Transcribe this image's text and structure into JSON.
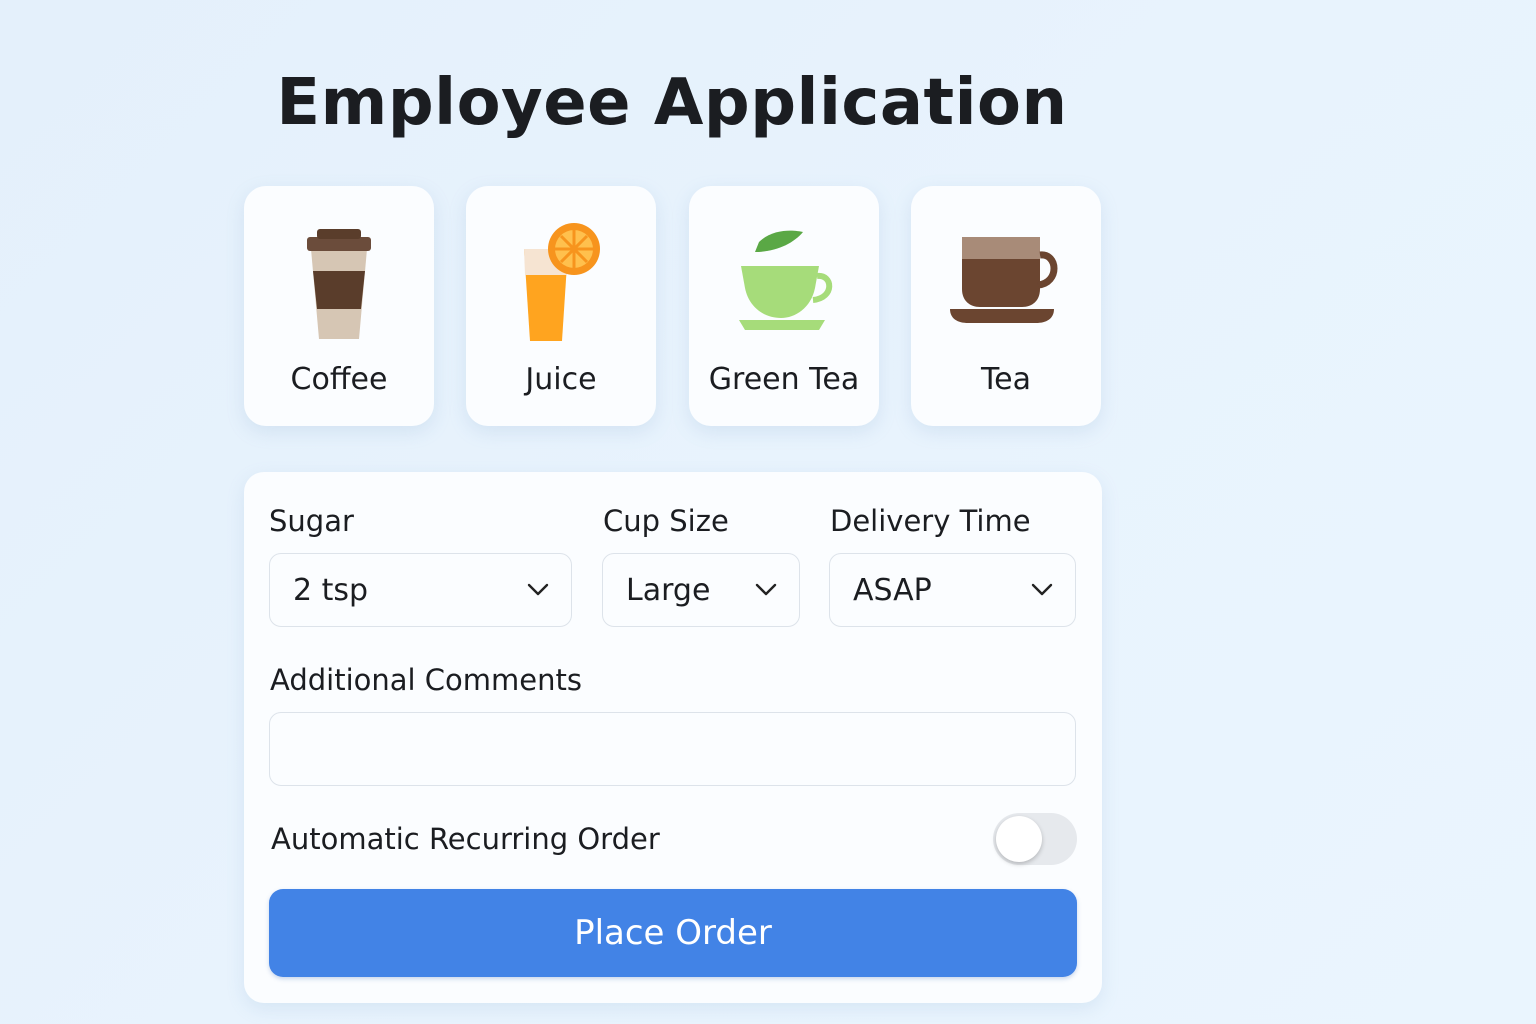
{
  "page": {
    "title": "Employee Application"
  },
  "drinks": [
    {
      "label": "Coffee",
      "icon": "coffee-cup-icon"
    },
    {
      "label": "Juice",
      "icon": "juice-glass-icon"
    },
    {
      "label": "Green Tea",
      "icon": "green-tea-cup-icon"
    },
    {
      "label": "Tea",
      "icon": "tea-cup-icon"
    }
  ],
  "form": {
    "sugar": {
      "label": "Sugar",
      "value": "2 tsp"
    },
    "cup_size": {
      "label": "Cup Size",
      "value": "Large"
    },
    "delivery_time": {
      "label": "Delivery Time",
      "value": "ASAP"
    },
    "comments": {
      "label": "Additional Comments",
      "value": ""
    },
    "recurring": {
      "label": "Automatic Recurring Order",
      "enabled": false
    },
    "submit_label": "Place Order"
  },
  "colors": {
    "accent": "#4283e6",
    "background": "#e6f2fc",
    "card": "#fbfdff"
  }
}
